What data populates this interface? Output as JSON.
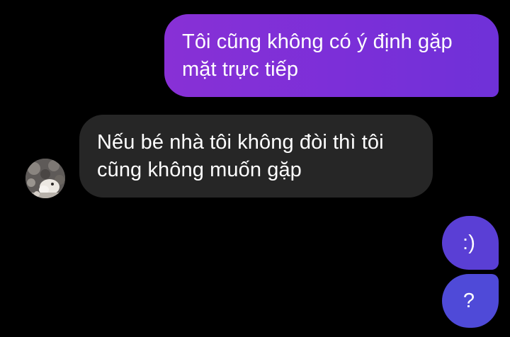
{
  "conversation": {
    "messages": [
      {
        "sender": "me",
        "text": "Tôi cũng không có ý định gặp mặt trực tiếp"
      },
      {
        "sender": "other",
        "text": "Nếu bé nhà tôi không đòi thì tôi cũng không muốn gặp"
      },
      {
        "sender": "me",
        "text": ":)"
      },
      {
        "sender": "me",
        "text": "?"
      }
    ],
    "other_avatar_icon": "profile-photo-avatar"
  },
  "colors": {
    "background": "#000000",
    "outgoing_bubble_top": "#7e2fd7",
    "outgoing_bubble_mid": "#5a3fd5",
    "outgoing_bubble_bottom": "#4f4ad8",
    "incoming_bubble": "#262626",
    "text": "#ffffff"
  }
}
